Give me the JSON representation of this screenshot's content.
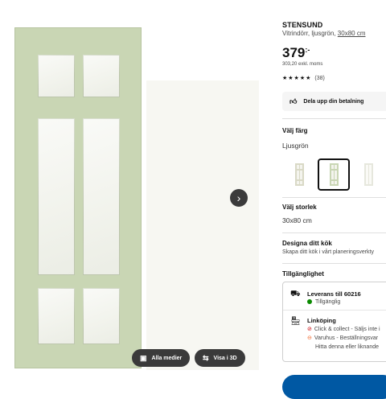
{
  "gallery": {
    "next_icon": "chevron-right-icon",
    "all_media_label": "Alla medier",
    "view_3d_label": "Visa i 3D"
  },
  "product": {
    "name": "STENSUND",
    "description": "Vitrindörr, ljusgrön,",
    "size_link": "30x80 cm",
    "price_main": "379",
    "price_suffix": ":-",
    "price_excl": "303,20 exkl. moms",
    "stars": "★★★★★",
    "rating_count": "(38)",
    "rating_value": 5
  },
  "payment": {
    "label": "Dela upp din betalning",
    "icon": "thumbs-up-icon"
  },
  "color": {
    "heading": "Välj färg",
    "selected": "Ljusgrön",
    "swatch_colors": [
      "#d9d9c6",
      "#c9d6b4",
      "#e6e7dd"
    ]
  },
  "size": {
    "heading": "Välj storlek",
    "selected": "30x80 cm"
  },
  "design": {
    "heading": "Designa ditt kök",
    "text": "Skapa ditt kök i vårt planeringsverkty"
  },
  "availability": {
    "heading": "Tillgänglighet",
    "delivery_title": "Leverans till 60216",
    "delivery_status": "Tillgänglig",
    "store_title": "Linköping",
    "store_line1": "Click & collect - Säljs inte i",
    "store_line2": "Varuhus - Beställningsvar",
    "store_line3": "Hitta denna eller liknande"
  },
  "colors": {
    "door": "#c9d6b4",
    "available": "#0a8a00",
    "unavailable": "#cc0008",
    "warning": "#f26a2e",
    "primary": "#0058a3"
  }
}
